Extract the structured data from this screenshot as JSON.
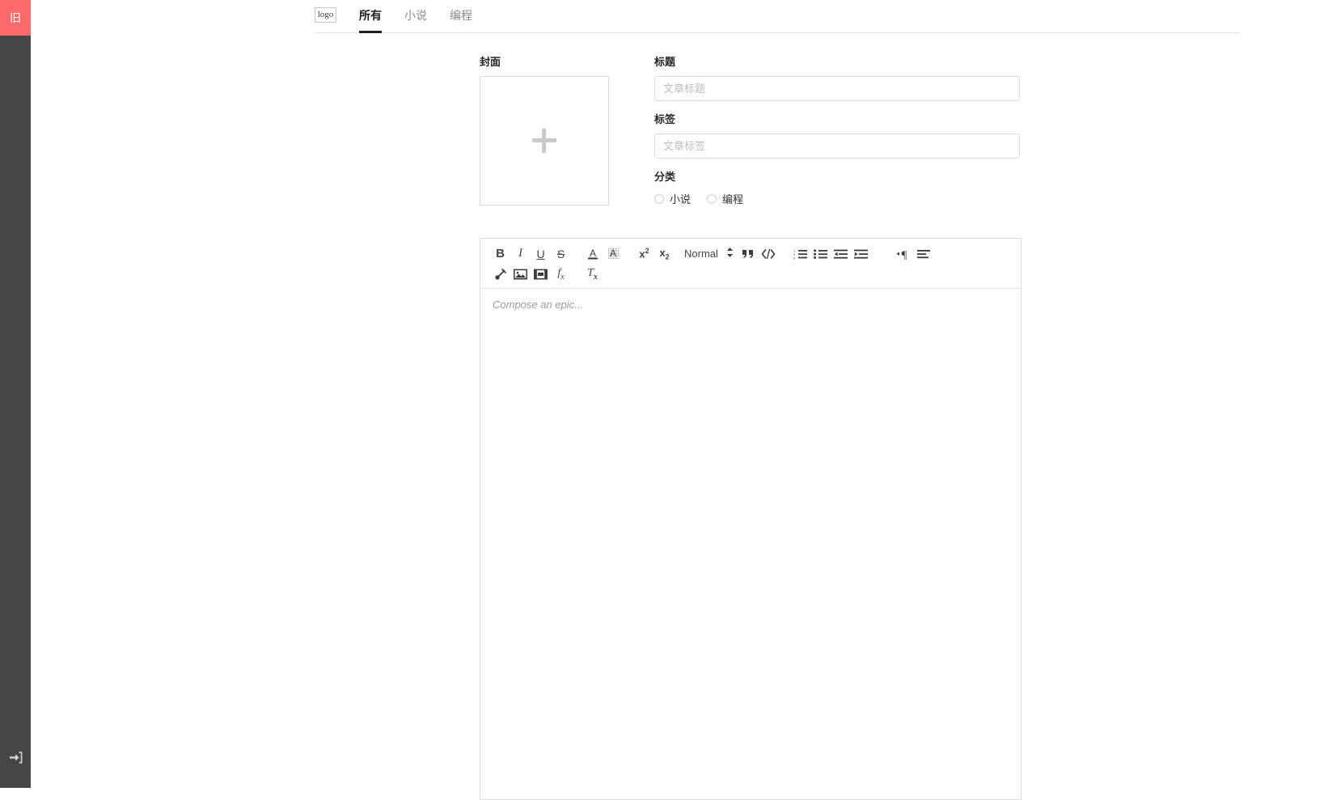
{
  "sidebar": {
    "brand_label": "旧",
    "brand_color": "#fc6b6b",
    "background_color": "#454545",
    "login_icon": "login-arrow-icon"
  },
  "tabbar": {
    "logo_alt": "logo",
    "tabs": [
      {
        "label": "所有",
        "active": true
      },
      {
        "label": "小说",
        "active": false
      },
      {
        "label": "编程",
        "active": false
      }
    ]
  },
  "form": {
    "cover": {
      "label": "封面",
      "add_icon": "plus-icon"
    },
    "title": {
      "label": "标题",
      "placeholder": "文章标题",
      "value": ""
    },
    "tags": {
      "label": "标签",
      "placeholder": "文章标签",
      "value": ""
    },
    "category": {
      "label": "分类",
      "options": [
        {
          "label": "小说",
          "selected": false
        },
        {
          "label": "编程",
          "selected": false
        }
      ]
    }
  },
  "editor": {
    "placeholder": "Compose an epic...",
    "format_select": {
      "value": "Normal",
      "chevron_icon": "chevron-updown-icon"
    },
    "toolbar_row_1": [
      {
        "name": "bold-icon",
        "glyph": "B"
      },
      {
        "name": "italic-icon",
        "glyph": "I"
      },
      {
        "name": "underline-icon",
        "glyph": "U"
      },
      {
        "name": "strikethrough-icon",
        "glyph": "S"
      },
      {
        "name": "text-color-icon",
        "glyph": "A"
      },
      {
        "name": "background-color-icon",
        "glyph": "A"
      },
      {
        "name": "superscript-icon",
        "glyph": "x²"
      },
      {
        "name": "subscript-icon",
        "glyph": "x₂"
      },
      {
        "name": "blockquote-icon",
        "glyph": "”"
      },
      {
        "name": "code-block-icon",
        "glyph": "</>"
      },
      {
        "name": "ordered-list-icon",
        "glyph": ""
      },
      {
        "name": "bullet-list-icon",
        "glyph": ""
      },
      {
        "name": "outdent-icon",
        "glyph": ""
      },
      {
        "name": "indent-icon",
        "glyph": ""
      },
      {
        "name": "text-direction-icon",
        "glyph": "¶"
      },
      {
        "name": "align-icon",
        "glyph": ""
      }
    ],
    "toolbar_row_2": [
      {
        "name": "link-icon",
        "glyph": ""
      },
      {
        "name": "image-icon",
        "glyph": ""
      },
      {
        "name": "video-icon",
        "glyph": ""
      },
      {
        "name": "formula-icon",
        "glyph": "fx"
      },
      {
        "name": "clear-format-icon",
        "glyph": "Tx"
      }
    ]
  }
}
